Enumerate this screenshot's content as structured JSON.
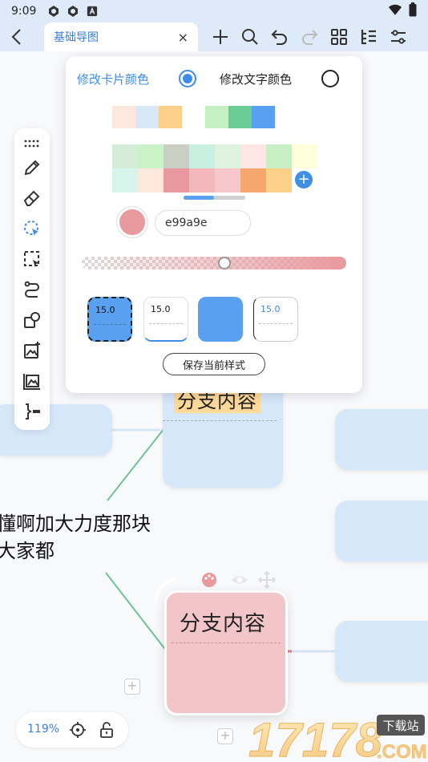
{
  "status_bar": {
    "time": "9:09"
  },
  "tab": {
    "title": "基础导图",
    "close_glyph": "×"
  },
  "toolbar": {
    "icons": [
      "plus-icon",
      "search-icon",
      "undo-icon",
      "redo-icon",
      "grid-icon",
      "outline-icon",
      "settings-sliders-icon"
    ]
  },
  "color_panel": {
    "card_color_label": "修改卡片颜色",
    "text_color_label": "修改文字颜色",
    "selected_option": "card",
    "recent_colors": [
      "#fde8df",
      "#d9e8f7",
      "#fdd08a"
    ],
    "recent_colors_2": [
      "#c4f0c4",
      "#6ccc96",
      "#5aa0f0"
    ],
    "palette": [
      [
        "#d5ecd8",
        "#c9f2c9",
        "#c9cfc3",
        "#c8efe0",
        "#def3de",
        "#fde6e4",
        "#c7f0c7",
        "#ffffdb"
      ],
      [
        "#d6f5ea",
        "#fde8de",
        "#e8989f",
        "#f4b8bc",
        "#f5c9cc",
        "#f5a76e",
        "#fdd08a"
      ]
    ],
    "hex_value": "e99a9e",
    "current_color": "#e99a9e",
    "opacity_level": 0.54,
    "styles": [
      {
        "value": "15.0"
      },
      {
        "value": "15.0"
      },
      {
        "value": ""
      },
      {
        "value": "15.0"
      }
    ],
    "save_button": "保存当前样式"
  },
  "mindmap": {
    "upper_node_title": "分支内容",
    "floating_text": "懂啊加大力度那块\n大家都",
    "selected_node_title": "分支内容"
  },
  "zoom": {
    "level": "119%"
  },
  "watermark": {
    "site": "17178",
    "domain": ".COM",
    "tag": "下载站"
  },
  "colors": {
    "accent": "#3d8de8",
    "link": "#3a7fd8",
    "topbar": "#dfeaf8"
  }
}
